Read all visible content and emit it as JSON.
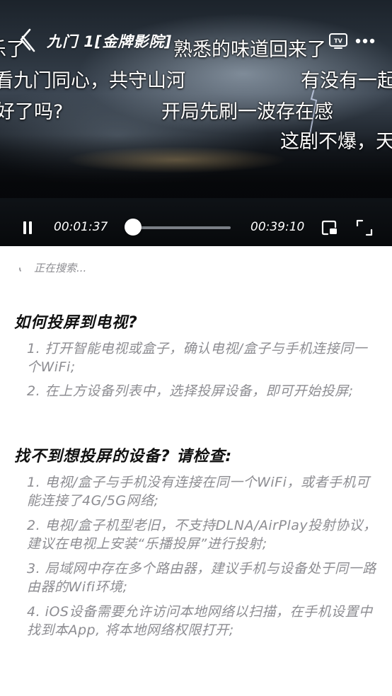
{
  "player": {
    "title": "九门 1[金牌影院]",
    "elapsed": "00:01:37",
    "duration": "00:39:10",
    "progress_fraction": 0.04,
    "danmaku": [
      "乐了",
      "熟悉的味道回来了",
      "看九门同心，共守山河",
      "有没有一起",
      "好了吗?",
      "开局先刷一波存在感",
      "这剧不爆，天"
    ]
  },
  "status": {
    "searching": "正在搜索..."
  },
  "help": {
    "title": "如何投屏到电视?",
    "steps": [
      "1. 打开智能电视或盒子，确认电视/盒子与手机连接同一个WiFi;",
      "2. 在上方设备列表中，选择投屏设备，即可开始投屏;"
    ]
  },
  "troubleshoot": {
    "title": "找不到想投屏的设备? 请检查:",
    "items": [
      "1. 电视/盒子与手机没有连接在同一个WiFi，或者手机可能连接了4G/5G网络;",
      "2. 电视/盒子机型老旧，不支持DLNA/AirPlay投射协议，建议在电视上安装“乐播投屏”进行投射;",
      "3. 局域网中存在多个路由器，建议手机与设备处于同一路由器的Wifi环境;",
      "4. iOS设备需要允许访问本地网络以扫描，在手机设置中找到本App, 将本地网络权限打开;"
    ]
  },
  "colors": {
    "accent": "#ffffff",
    "muted_text": "#8d8d92",
    "heading": "#111111"
  },
  "icons": {
    "back": "chevron-left-icon",
    "tv": "tv-icon",
    "more": "more-dots-icon",
    "pause": "pause-icon",
    "pip": "picture-in-picture-icon",
    "fullscreen": "fullscreen-icon",
    "spinner": "loading-spinner-icon"
  }
}
